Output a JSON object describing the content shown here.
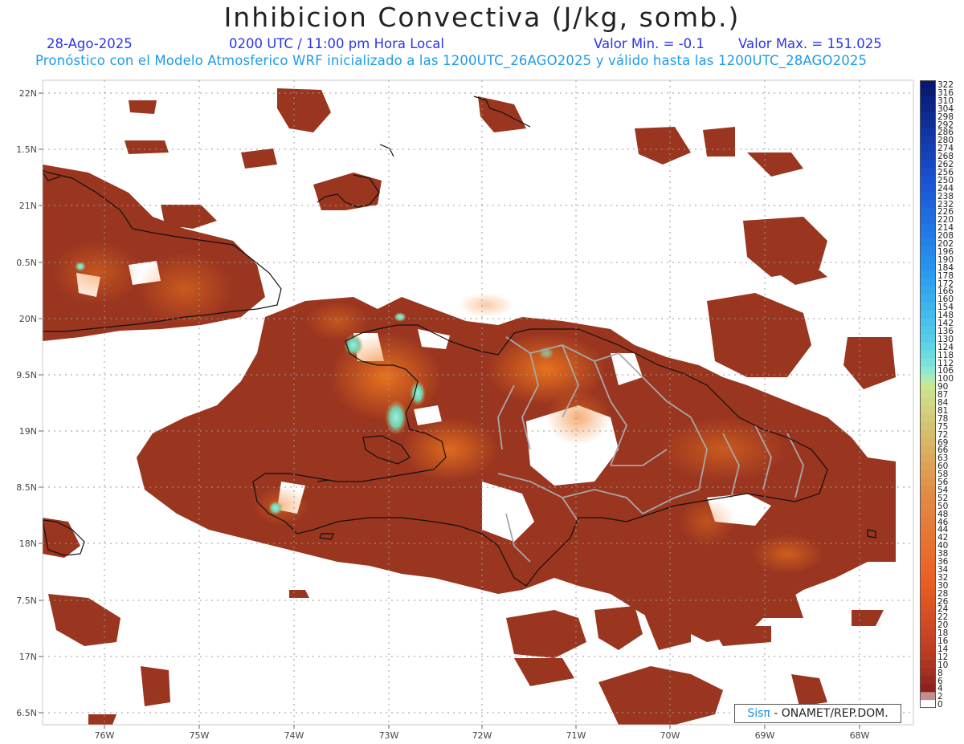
{
  "header": {
    "title": "Inhibicion Convectiva (J/kg, somb.)",
    "date": "28-Ago-2025",
    "time": "0200 UTC / 11:00 pm Hora Local",
    "min_label": "Valor Min. = -0.1",
    "max_label": "Valor Max. = 151.025",
    "forecast_note": "Pronóstico con el Modelo Atmosferico WRF inicializado a las 1200UTC_26AGO2025 y válido hasta las  1200UTC_28AGO2025"
  },
  "map": {
    "lat_ticks": [
      "22N",
      "1.5N",
      "21N",
      "0.5N",
      "20N",
      "9.5N",
      "19N",
      "8.5N",
      "18N",
      "7.5N",
      "17N",
      "6.5N"
    ],
    "lon_ticks": [
      "76W",
      "75W",
      "74W",
      "73W",
      "72W",
      "71W",
      "70W",
      "69W",
      "68W"
    ],
    "colors": {
      "land_low": "#8b2e1e",
      "land_mid": "#c8431e",
      "land_high": "#ec6e1e",
      "peak": "#7fe0c8",
      "coastline": "#111111",
      "province_border": "#9a9a9a",
      "grid": "#9a9a9a"
    }
  },
  "colorbar": {
    "labels": [
      "322",
      "316",
      "310",
      "304",
      "298",
      "292",
      "286",
      "280",
      "274",
      "268",
      "262",
      "256",
      "250",
      "244",
      "238",
      "232",
      "226",
      "220",
      "214",
      "208",
      "202",
      "196",
      "190",
      "184",
      "178",
      "172",
      "166",
      "160",
      "154",
      "148",
      "142",
      "136",
      "130",
      "124",
      "118",
      "112",
      "106",
      "100",
      "90",
      "87",
      "84",
      "81",
      "78",
      "75",
      "72",
      "69",
      "66",
      "63",
      "60",
      "58",
      "56",
      "54",
      "52",
      "50",
      "48",
      "46",
      "44",
      "42",
      "40",
      "38",
      "36",
      "34",
      "32",
      "30",
      "28",
      "26",
      "24",
      "22",
      "20",
      "18",
      "16",
      "14",
      "12",
      "10",
      "8",
      "6",
      "4",
      "2",
      "0"
    ]
  },
  "credit": {
    "brand": "Sisπ",
    "text": " - ONAMET/REP.DOM."
  }
}
